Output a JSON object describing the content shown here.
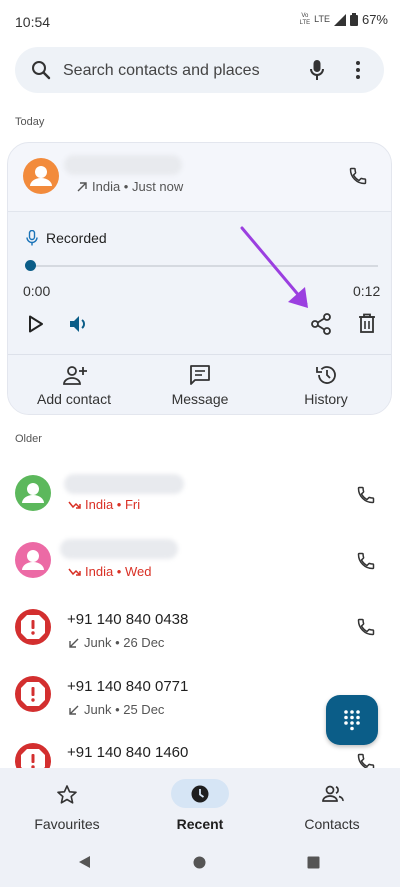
{
  "status_bar": {
    "time": "10:54",
    "battery": "67%",
    "network_1": "Vo))\nLTE",
    "network_2": "LTE"
  },
  "search": {
    "placeholder": "Search contacts and places"
  },
  "sections": {
    "today": "Today",
    "older": "Older"
  },
  "expanded_call": {
    "meta": "India • Just now",
    "recording_label": "Recorded",
    "time_start": "0:00",
    "time_end": "0:12",
    "playback_progress": 0,
    "actions": [
      {
        "label": "Add contact",
        "icon": "person-add-icon"
      },
      {
        "label": "Message",
        "icon": "message-icon"
      },
      {
        "label": "History",
        "icon": "history-icon"
      }
    ]
  },
  "calls": [
    {
      "number": "",
      "meta": "India • Fri",
      "type": "missed",
      "avatar_color": "#5cb85c"
    },
    {
      "number": "",
      "meta": "India • Wed",
      "type": "missed",
      "avatar_color": "#ec6aa5"
    },
    {
      "number": "+91 140 840 0438",
      "meta": "Junk • 26 Dec",
      "type": "incoming",
      "avatar_color": "#d32f2f"
    },
    {
      "number": "+91 140 840 0771",
      "meta": "Junk • 25 Dec",
      "type": "incoming",
      "avatar_color": "#d32f2f"
    },
    {
      "number": "+91 140 840 1460",
      "meta": "",
      "type": "incoming",
      "avatar_color": "#d32f2f"
    }
  ],
  "bottom_nav": [
    {
      "label": "Favourites",
      "icon": "star-icon"
    },
    {
      "label": "Recent",
      "icon": "clock-icon",
      "selected": true
    },
    {
      "label": "Contacts",
      "icon": "people-icon"
    }
  ],
  "colors": {
    "accent": "#0b5d88",
    "missed": "#d93025",
    "selected_pill": "#d6e5f5",
    "annotation_arrow": "#9b3fe0"
  }
}
